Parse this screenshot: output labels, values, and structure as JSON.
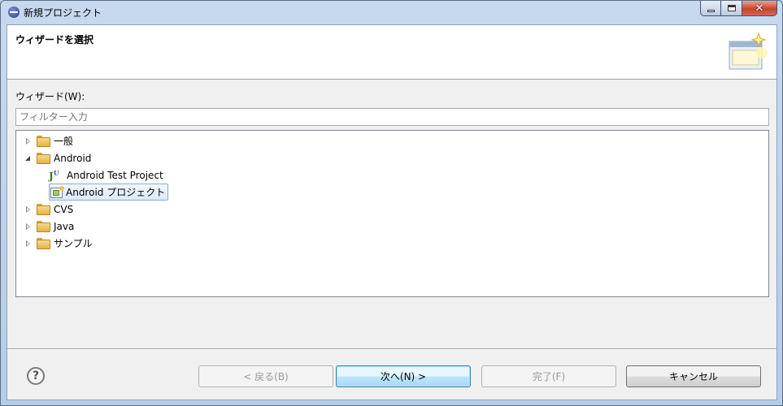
{
  "window": {
    "title": "新規プロジェクト"
  },
  "header": {
    "title": "ウィザードを選択"
  },
  "wizard": {
    "label": "ウィザード(W):",
    "filter_placeholder": "フィルター入力"
  },
  "tree": {
    "items": [
      {
        "label": "一般",
        "expanded": false
      },
      {
        "label": "Android",
        "expanded": true
      },
      {
        "label": "Android Test Project"
      },
      {
        "label": "Android プロジェクト",
        "selected": true
      },
      {
        "label": "CVS",
        "expanded": false
      },
      {
        "label": "Java",
        "expanded": false
      },
      {
        "label": "サンプル",
        "expanded": false
      }
    ]
  },
  "buttons": {
    "back": "< 戻る(B)",
    "next": "次へ(N) >",
    "finish": "完了(F)",
    "cancel": "キャンセル"
  },
  "icons": {
    "help": "?",
    "close": "✕"
  }
}
